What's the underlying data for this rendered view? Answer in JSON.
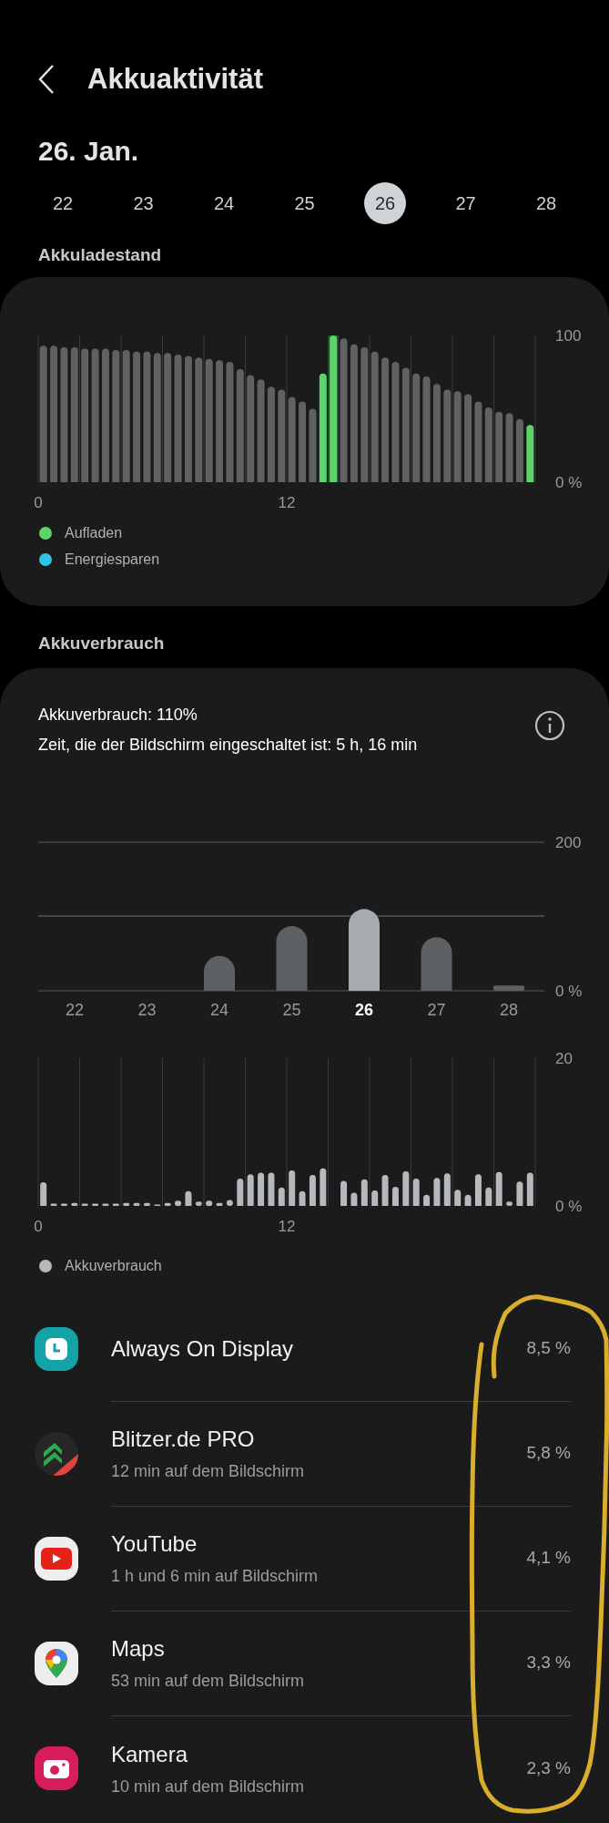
{
  "header": {
    "title": "Akkuaktivität"
  },
  "date_title": "26. Jan.",
  "days": [
    {
      "label": "22",
      "selected": false
    },
    {
      "label": "23",
      "selected": false
    },
    {
      "label": "24",
      "selected": false
    },
    {
      "label": "25",
      "selected": false
    },
    {
      "label": "26",
      "selected": true
    },
    {
      "label": "27",
      "selected": false
    },
    {
      "label": "28",
      "selected": false
    }
  ],
  "battery_level": {
    "heading": "Akkuladestand",
    "chart_data": {
      "type": "bar",
      "x": [
        0.25,
        0.75,
        1.25,
        1.75,
        2.25,
        2.75,
        3.25,
        3.75,
        4.25,
        4.75,
        5.25,
        5.75,
        6.25,
        6.75,
        7.25,
        7.75,
        8.25,
        8.75,
        9.25,
        9.75,
        10.25,
        10.75,
        11.25,
        11.75,
        12.25,
        12.75,
        13.25,
        13.75,
        14.25,
        14.75,
        15.25,
        15.75,
        16.25,
        16.75,
        17.25,
        17.75,
        18.25,
        18.75,
        19.25,
        19.75,
        20.25,
        20.75,
        21.25,
        21.75,
        22.25,
        22.75,
        23.25,
        23.75
      ],
      "series": [
        {
          "color": "#5f6163",
          "values": [
            93,
            93,
            92,
            92,
            91,
            91,
            91,
            90,
            90,
            89,
            89,
            88,
            88,
            87,
            86,
            85,
            84,
            83,
            82,
            77,
            73,
            70,
            65,
            63,
            58,
            55,
            50,
            null,
            null,
            98,
            94,
            92,
            89,
            85,
            82,
            78,
            74,
            72,
            67,
            63,
            62,
            60,
            55,
            51,
            48,
            47,
            43,
            null
          ]
        },
        {
          "name": "Aufladen",
          "color": "#5bd46a",
          "values": [
            null,
            null,
            null,
            null,
            null,
            null,
            null,
            null,
            null,
            null,
            null,
            null,
            null,
            null,
            null,
            null,
            null,
            null,
            null,
            null,
            null,
            null,
            null,
            null,
            null,
            null,
            null,
            74,
            100,
            null,
            null,
            null,
            null,
            null,
            null,
            null,
            null,
            null,
            null,
            null,
            null,
            null,
            null,
            null,
            null,
            null,
            null,
            39
          ]
        }
      ],
      "xlim": [
        0,
        24
      ],
      "ylim": [
        0,
        100
      ],
      "yticks": [
        {
          "value": 0,
          "label": "0 %"
        },
        {
          "value": 100,
          "label": "100"
        }
      ],
      "xticks": [
        {
          "value": 0,
          "label": "0"
        },
        {
          "value": 12,
          "label": "12"
        }
      ]
    },
    "legend": [
      {
        "label": "Energiesparen",
        "color": "#2ec4e6"
      }
    ]
  },
  "usage": {
    "heading": "Akkuverbrauch",
    "total": "Akkuverbrauch: 110%",
    "screen_time": "Zeit, die der Bildschirm eingeschaltet ist: 5 h, 16 min",
    "daily_chart": {
      "chart_data": {
        "type": "bar",
        "categories": [
          "22",
          "23",
          "24",
          "25",
          "26",
          "27",
          "28"
        ],
        "values": [
          0,
          0,
          47,
          87,
          110,
          72,
          7
        ],
        "ylim": [
          0,
          200
        ],
        "yticks": [
          {
            "value": 0,
            "label": "0 %"
          },
          {
            "value": 200,
            "label": "200"
          }
        ]
      }
    },
    "hourly_chart": {
      "chart_data": {
        "type": "bar",
        "x": [
          0.25,
          0.75,
          1.25,
          1.75,
          2.25,
          2.75,
          3.25,
          3.75,
          4.25,
          4.75,
          5.25,
          5.75,
          6.25,
          6.75,
          7.25,
          7.75,
          8.25,
          8.75,
          9.25,
          9.75,
          10.25,
          10.75,
          11.25,
          11.75,
          12.25,
          12.75,
          13.25,
          13.75,
          14.25,
          14.75,
          15.25,
          15.75,
          16.25,
          16.75,
          17.25,
          17.75,
          18.25,
          18.75,
          19.25,
          19.75,
          20.25,
          20.75,
          21.25,
          21.75,
          22.25,
          22.75,
          23.25,
          23.75
        ],
        "series": [
          {
            "name": "Akkuverbrauch",
            "color": "#b5b9bd",
            "values": [
              3.2,
              0.3,
              0.3,
              0.4,
              0.3,
              0.3,
              0.3,
              0.3,
              0.4,
              0.4,
              0.4,
              0.2,
              0.4,
              0.7,
              2.0,
              0.6,
              0.7,
              0.4,
              0.8,
              3.7,
              4.3,
              4.5,
              4.5,
              2.5,
              4.8,
              2.0,
              4.2,
              5.1,
              null,
              3.4,
              1.8,
              3.6,
              2.1,
              4.2,
              2.6,
              4.7,
              3.7,
              1.5,
              3.8,
              4.4,
              2.2,
              1.5,
              4.3,
              2.5,
              4.6,
              0.6,
              3.3,
              4.5
            ]
          }
        ],
        "xlim": [
          0,
          24
        ],
        "ylim": [
          0,
          20
        ],
        "yticks": [
          {
            "value": 0,
            "label": "0 %"
          },
          {
            "value": 20,
            "label": "20"
          }
        ],
        "xticks": [
          {
            "value": 0,
            "label": "0"
          },
          {
            "value": 12,
            "label": "12"
          }
        ]
      }
    }
  },
  "apps": [
    {
      "name": "Always On Display",
      "percent": "8,5 %",
      "kind": "clock"
    },
    {
      "name": "Blitzer.de PRO",
      "detail": "12 min auf dem Bildschirm",
      "percent": "5,8 %",
      "kind": "chevrons"
    },
    {
      "name": "YouTube",
      "detail": "1 h und 6 min auf Bildschirm",
      "percent": "4,1 %",
      "kind": "play"
    },
    {
      "name": "Maps",
      "detail": "53 min auf dem Bildschirm",
      "percent": "3,3 %",
      "kind": "pin"
    },
    {
      "name": "Kamera",
      "detail": "10 min auf dem Bildschirm",
      "percent": "2,3 %",
      "kind": "camera"
    }
  ]
}
